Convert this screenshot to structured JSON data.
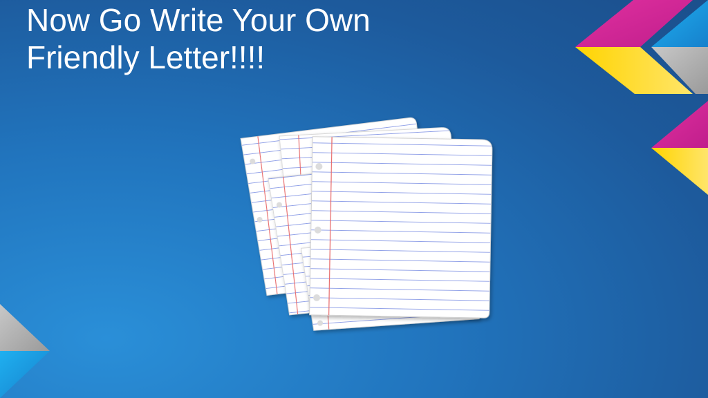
{
  "slide": {
    "title_line1": "Now Go Write Your Own",
    "title_line2": "Friendly Letter!!!!"
  },
  "icons": {
    "illustration": "lined-paper-stack-icon"
  },
  "colors": {
    "background_light": "#2a8fd8",
    "background_dark": "#1b4f8c",
    "accent_magenta": "#d6249f",
    "accent_yellow": "#ffd20a",
    "accent_gray": "#b8b8b8",
    "accent_cyan": "#1aa3e8",
    "paper_line": "#8fa0e8",
    "paper_margin": "#e86a6a"
  }
}
